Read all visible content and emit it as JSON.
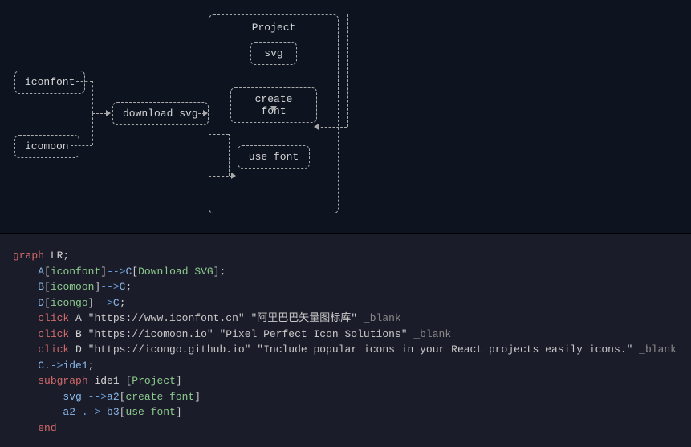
{
  "diagram": {
    "nodes": {
      "iconfont": "iconfont",
      "icomoon": "icomoon",
      "download": "download svg",
      "svg": "svg",
      "createfont": "create font",
      "usefont": "use font"
    },
    "subgraph_title": "Project"
  },
  "code": {
    "l1_graph": "graph",
    "l1_lr": " LR",
    "l2_a": "A",
    "l2_iconfont": "iconfont",
    "l2_arrow": "-->",
    "l2_c": "C",
    "l2_dl": "Download SVG",
    "l3_b": "B",
    "l3_icomoon": "icomoon",
    "l3_arrow": "-->",
    "l3_c": "C",
    "l4_d": "D",
    "l4_icongo": "icongo",
    "l4_arrow": "-->",
    "l4_c": "C",
    "l5_click": "click",
    "l5_a": " A ",
    "l5_url": "\"https://www.iconfont.cn\"",
    "l5_title": "\"阿里巴巴矢量图标库\"",
    "l5_blank": " _blank",
    "l6_b": " B ",
    "l6_url": "\"https://icomoon.io\"",
    "l6_title": "\"Pixel Perfect Icon Solutions\"",
    "l7_d": " D ",
    "l7_url": "\"https://icongo.github.io\"",
    "l7_title": "\"Include popular icons in your React projects easily icons.\"",
    "l8_c": "C",
    "l8_dot": ".->",
    "l8_ide1": "ide1",
    "l9_subgraph": "subgraph",
    "l9_ide1": " ide1 ",
    "l9_proj": "Project",
    "l10_svg": "svg ",
    "l10_arrow": "-->",
    "l10_a2": "a2",
    "l10_cf": "create font",
    "l11_a2": "a2 ",
    "l11_dot": ".->",
    "l11_b3": " b3",
    "l11_uf": "use font",
    "l12_end": "end"
  }
}
